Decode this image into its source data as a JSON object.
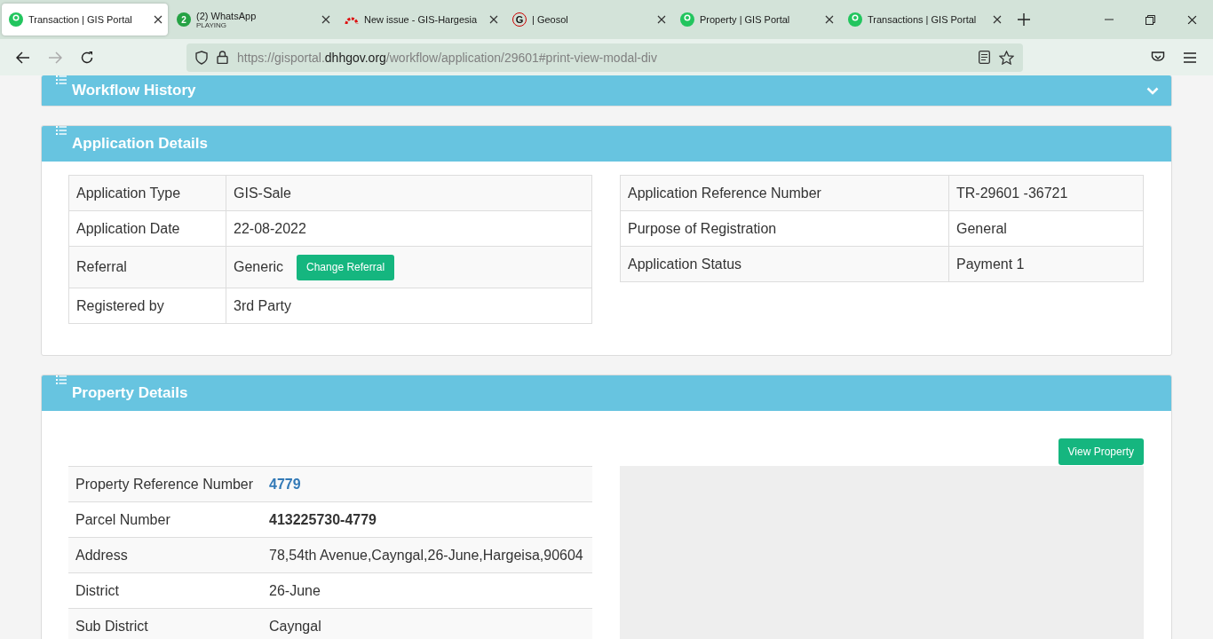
{
  "browser": {
    "tabs": [
      {
        "title": "Transaction | GIS Portal",
        "kind": "portal",
        "selected": true
      },
      {
        "title": "(2) WhatsApp",
        "subtitle": "PLAYING",
        "kind": "badge",
        "badge": "2",
        "selected": false
      },
      {
        "title": "New issue - GIS-Hargesia",
        "kind": "gauge",
        "selected": false
      },
      {
        "title": "| Geosol",
        "kind": "letter",
        "badge": "G",
        "selected": false
      },
      {
        "title": "Property | GIS Portal",
        "kind": "portal",
        "selected": false
      },
      {
        "title": "Transactions | GIS Portal",
        "kind": "portal",
        "selected": false
      }
    ],
    "url": {
      "prefix": "https://gisportal.",
      "domain": "dhhgov.org",
      "path": "/workflow/application/29601#print-view-modal-div"
    }
  },
  "workflow_history": {
    "title": "Workflow History",
    "expanded": false
  },
  "application_details": {
    "title": "Application Details",
    "left_rows": [
      {
        "label": "Application Type",
        "value": "GIS-Sale"
      },
      {
        "label": "Application Date",
        "value": "22-08-2022"
      },
      {
        "label": "Referral",
        "value": "Generic",
        "button": "Change Referral"
      },
      {
        "label": "Registered by",
        "value": "3rd Party"
      }
    ],
    "right_rows": [
      {
        "label": "Application Reference Number",
        "value": "TR-29601 -36721"
      },
      {
        "label": "Purpose of Registration",
        "value": "General"
      },
      {
        "label": "Application Status",
        "value": "Payment 1"
      }
    ]
  },
  "property_details": {
    "title": "Property Details",
    "button": "View Property",
    "rows": [
      {
        "label": "Property Reference Number",
        "value": "4779",
        "kind": "link"
      },
      {
        "label": "Parcel Number",
        "value": "413225730-4779",
        "kind": "bold"
      },
      {
        "label": "Address",
        "value": "78,54th Avenue,Cayngal,26-June,Hargeisa,90604",
        "kind": "plain"
      },
      {
        "label": "District",
        "value": "26-June",
        "kind": "plain"
      },
      {
        "label": "Sub District",
        "value": "Cayngal",
        "kind": "plain"
      }
    ]
  }
}
